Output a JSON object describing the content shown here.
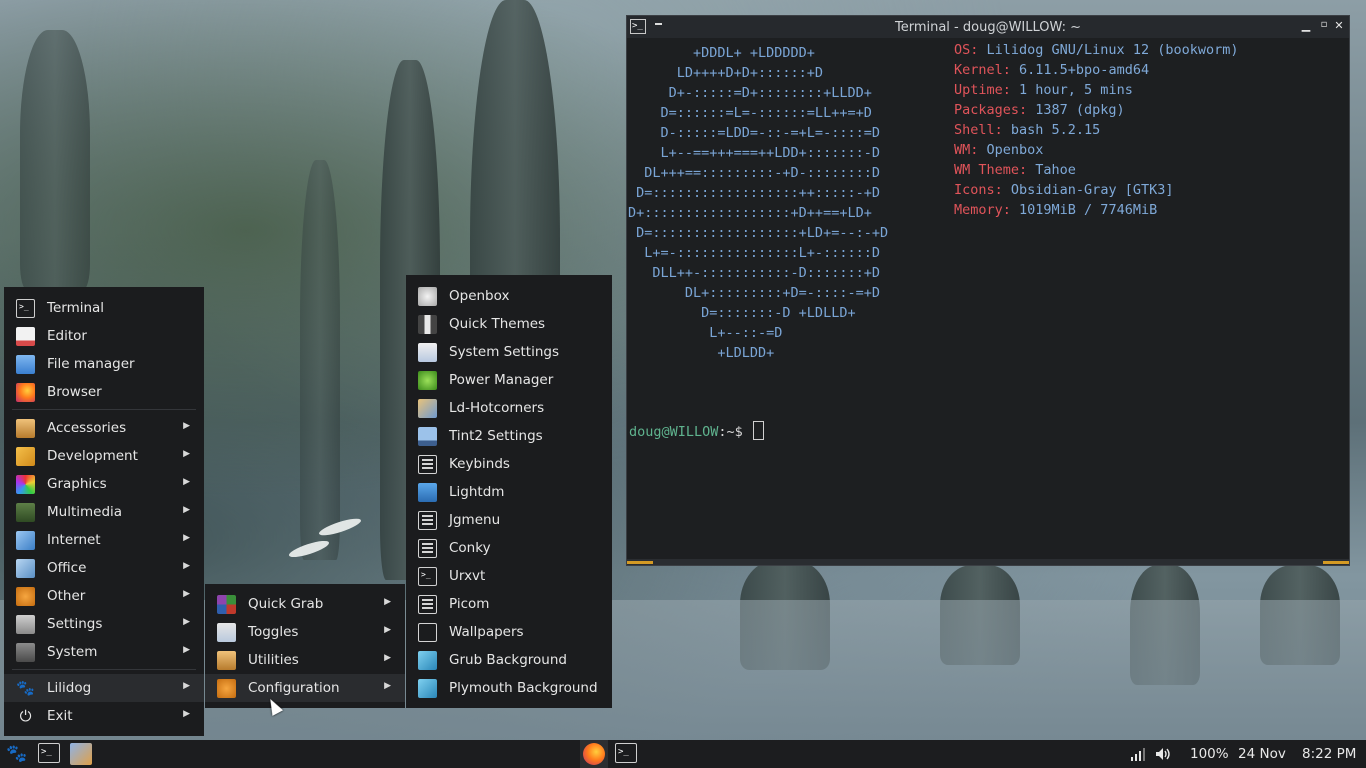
{
  "terminal": {
    "title": "Terminal - doug@WILLOW: ~",
    "ascii_art": [
      "        +DDDL+ +LDDDDD+",
      "      LD++++D+D+::::::+D",
      "     D+-:::::=D+::::::::+LLDD+",
      "    D=::::::=L=-::::::=LL++=+D",
      "    D-:::::=LDD=-::-=+L=-::::=D",
      "    L+--==+++===++LDD+:::::::-D",
      "  DL+++==:::::::::-+D-::::::::D",
      " D=::::::::::::::::::++:::::-+D",
      "D+::::::::::::::::::+D++==+LD+",
      " D=::::::::::::::::::+LD+=--:-+D",
      "  L+=-:::::::::::::::L+-::::::D",
      "   DLL++-:::::::::::-D:::::::+D",
      "       DL+:::::::::+D=-::::-=+D",
      "         D=:::::::-D +LDLLD+",
      "          L+--::-=D",
      "           +LDLDD+"
    ],
    "info": [
      {
        "key": "OS:",
        "value": " Lilidog GNU/Linux 12 (bookworm)"
      },
      {
        "key": "Kernel:",
        "value": " 6.11.5+bpo-amd64"
      },
      {
        "key": "Uptime:",
        "value": " 1 hour, 5 mins"
      },
      {
        "key": "Packages:",
        "value": " 1387 (dpkg)"
      },
      {
        "key": "Shell:",
        "value": " bash 5.2.15"
      },
      {
        "key": "WM:",
        "value": " Openbox"
      },
      {
        "key": "WM Theme:",
        "value": " Tahoe"
      },
      {
        "key": "Icons:",
        "value": " Obsidian-Gray [GTK3]"
      },
      {
        "key": "Memory:",
        "value": " 1019MiB / 7746MiB"
      }
    ],
    "prompt_user": "doug@WILLOW",
    "prompt_rest": ":~$"
  },
  "main_menu": {
    "items": [
      {
        "label": "Terminal",
        "icon": "terminal-icon"
      },
      {
        "label": "Editor",
        "icon": "editor-icon"
      },
      {
        "label": "File manager",
        "icon": "file-manager-icon"
      },
      {
        "label": "Browser",
        "icon": "firefox-icon"
      },
      {
        "label": "Accessories",
        "icon": "accessories-icon"
      },
      {
        "label": "Development",
        "icon": "development-icon"
      },
      {
        "label": "Graphics",
        "icon": "graphics-icon"
      },
      {
        "label": "Multimedia",
        "icon": "multimedia-icon"
      },
      {
        "label": "Internet",
        "icon": "internet-icon"
      },
      {
        "label": "Office",
        "icon": "office-icon"
      },
      {
        "label": "Other",
        "icon": "other-icon"
      },
      {
        "label": "Settings",
        "icon": "settings-icon"
      },
      {
        "label": "System",
        "icon": "system-icon"
      },
      {
        "label": "Lilidog",
        "icon": "paw-icon"
      },
      {
        "label": "Exit",
        "icon": "power-icon"
      }
    ],
    "submenu_arrow": "▶"
  },
  "lilidog_menu": {
    "items": [
      {
        "label": "Quick Grab",
        "icon": "quick-grab-icon"
      },
      {
        "label": "Toggles",
        "icon": "toggles-icon"
      },
      {
        "label": "Utilities",
        "icon": "utilities-icon"
      },
      {
        "label": "Configuration",
        "icon": "configuration-icon"
      }
    ]
  },
  "config_menu": {
    "items": [
      {
        "label": "Openbox",
        "icon": "openbox-icon"
      },
      {
        "label": "Quick Themes",
        "icon": "quick-themes-icon"
      },
      {
        "label": "System Settings",
        "icon": "system-settings-icon"
      },
      {
        "label": "Power Manager",
        "icon": "battery-icon"
      },
      {
        "label": "Ld-Hotcorners",
        "icon": "hotcorners-icon"
      },
      {
        "label": "Tint2 Settings",
        "icon": "tint2-icon"
      },
      {
        "label": "Keybinds",
        "icon": "text-file-icon"
      },
      {
        "label": "Lightdm",
        "icon": "lightdm-icon"
      },
      {
        "label": "Jgmenu",
        "icon": "text-file-icon"
      },
      {
        "label": "Conky",
        "icon": "text-file-icon"
      },
      {
        "label": "Urxvt",
        "icon": "terminal-icon"
      },
      {
        "label": "Picom",
        "icon": "text-file-icon"
      },
      {
        "label": "Wallpapers",
        "icon": "wallpapers-icon"
      },
      {
        "label": "Grub Background",
        "icon": "image-icon"
      },
      {
        "label": "Plymouth Background",
        "icon": "image-icon"
      }
    ]
  },
  "taskbar": {
    "volume": "100%",
    "date": "24 Nov",
    "time": "8:22 PM"
  },
  "colors": {
    "menu_bg": "#1b1c1e",
    "info_key": "#e0545a",
    "info_value": "#7fa9d8",
    "prompt_user": "#5fb38e",
    "accent_orange": "#d49a24"
  }
}
